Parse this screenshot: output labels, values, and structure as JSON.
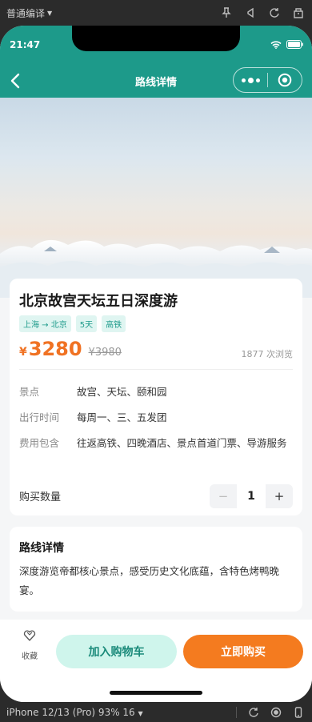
{
  "devtools": {
    "compile_mode": "普通编译",
    "device_label": "iPhone 12/13 (Pro) 93% 16"
  },
  "status": {
    "time": "21:47"
  },
  "nav": {
    "title": "路线详情"
  },
  "product": {
    "title": "北京故宫天坛五日深度游",
    "tags": [
      "上海 → 北京",
      "5天",
      "高铁"
    ],
    "price_symbol": "¥",
    "price": "3280",
    "original_price": "¥3980",
    "views": "1877 次浏览",
    "info": [
      {
        "key": "景点",
        "value": "故宫、天坛、颐和园"
      },
      {
        "key": "出行时间",
        "value": "每周一、三、五发团"
      },
      {
        "key": "费用包含",
        "value": "往返高铁、四晚酒店、景点首道门票、导游服务"
      }
    ],
    "quantity_label": "购买数量",
    "quantity": "1",
    "minus": "−",
    "plus": "+"
  },
  "details": {
    "title": "路线详情",
    "body": "深度游览帝都核心景点，感受历史文化底蕴，含特色烤鸭晚宴。"
  },
  "bottom_bar": {
    "favorite_label": "收藏",
    "add_to_cart": "加入购物车",
    "buy_now": "立即购买"
  },
  "colors": {
    "header": "#1d9a8a",
    "accent_orange": "#f47b1f",
    "price": "#f07223",
    "cart_bg": "#cff5ec"
  }
}
